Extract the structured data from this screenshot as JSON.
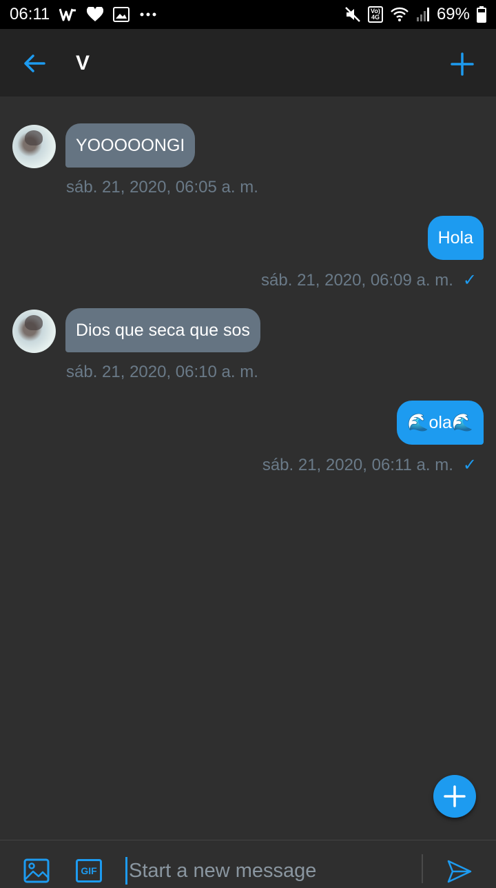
{
  "status_bar": {
    "time": "06:11",
    "battery": "69%",
    "network_badge_top": "Vo)",
    "network_badge_bottom": "4G"
  },
  "header": {
    "title": "V",
    "back_icon": "arrow-left-icon",
    "add_icon": "plus-icon"
  },
  "accent_color": "#1d9bf0",
  "incoming_bubble_color": "#657482",
  "messages": [
    {
      "direction": "in",
      "text": "YOOOOONGI",
      "timestamp": "sáb. 21, 2020, 06:05 a. m."
    },
    {
      "direction": "out",
      "text": "Hola",
      "timestamp": "sáb. 21, 2020, 06:09 a. m.",
      "status": "✓"
    },
    {
      "direction": "in",
      "text": "Dios que seca que sos",
      "timestamp": "sáb. 21, 2020, 06:10 a. m."
    },
    {
      "direction": "out",
      "text": "🌊ola🌊",
      "timestamp": "sáb. 21, 2020, 06:11 a. m.",
      "status": "✓"
    }
  ],
  "composer": {
    "placeholder": "Start a new message",
    "gif_label": "GIF"
  }
}
